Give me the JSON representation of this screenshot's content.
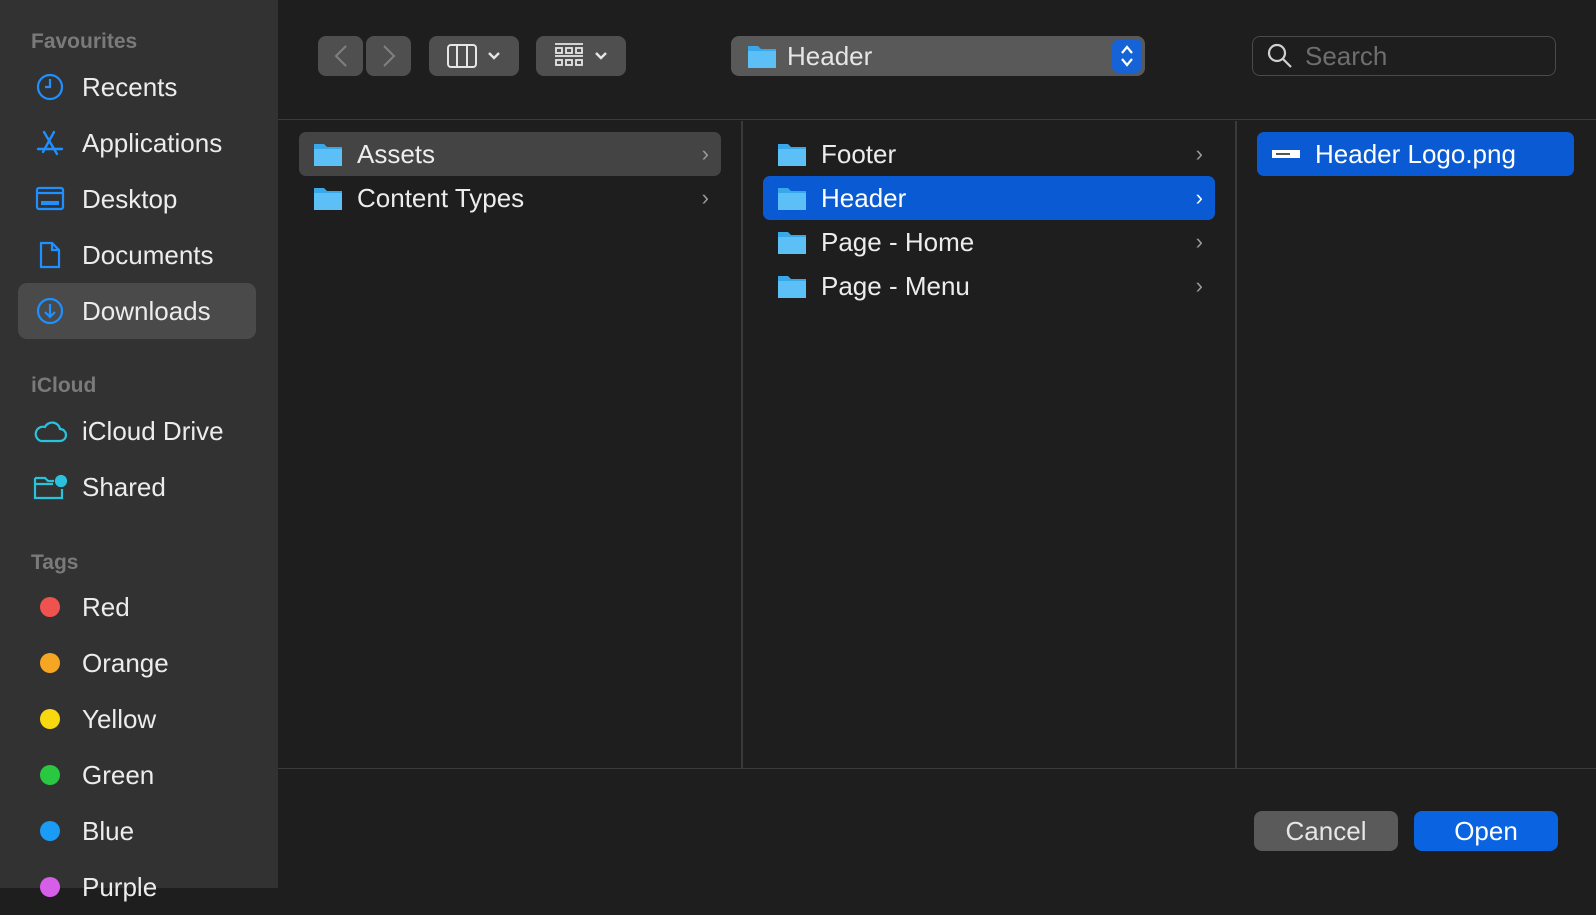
{
  "sidebar": {
    "sections": [
      {
        "title": "Favourites",
        "items": [
          {
            "label": "Recents",
            "icon": "clock-icon"
          },
          {
            "label": "Applications",
            "icon": "app-store-icon"
          },
          {
            "label": "Desktop",
            "icon": "desktop-icon"
          },
          {
            "label": "Documents",
            "icon": "document-icon"
          },
          {
            "label": "Downloads",
            "icon": "download-icon",
            "selected": true
          }
        ]
      },
      {
        "title": "iCloud",
        "items": [
          {
            "label": "iCloud Drive",
            "icon": "cloud-icon"
          },
          {
            "label": "Shared",
            "icon": "shared-folder-icon"
          }
        ]
      },
      {
        "title": "Tags",
        "items": [
          {
            "label": "Red",
            "color": "#f0524f"
          },
          {
            "label": "Orange",
            "color": "#f5a623"
          },
          {
            "label": "Yellow",
            "color": "#f8d90f"
          },
          {
            "label": "Green",
            "color": "#2ac840"
          },
          {
            "label": "Blue",
            "color": "#1a9bf5"
          },
          {
            "label": "Purple",
            "color": "#d65fe8"
          }
        ]
      }
    ]
  },
  "toolbar": {
    "path": "Header",
    "search_placeholder": "Search"
  },
  "columns": [
    [
      {
        "label": "Assets",
        "state": "parent-selected"
      },
      {
        "label": "Content Types"
      }
    ],
    [
      {
        "label": "Footer"
      },
      {
        "label": "Header",
        "state": "selected"
      },
      {
        "label": "Page - Home"
      },
      {
        "label": "Page - Menu"
      }
    ],
    [
      {
        "label": "Header Logo.png",
        "state": "selected",
        "type": "file"
      }
    ]
  ],
  "footer": {
    "cancel": "Cancel",
    "open": "Open"
  },
  "colors": {
    "accent": "#0a5bd3",
    "icon_blue": "#1e90ff"
  }
}
